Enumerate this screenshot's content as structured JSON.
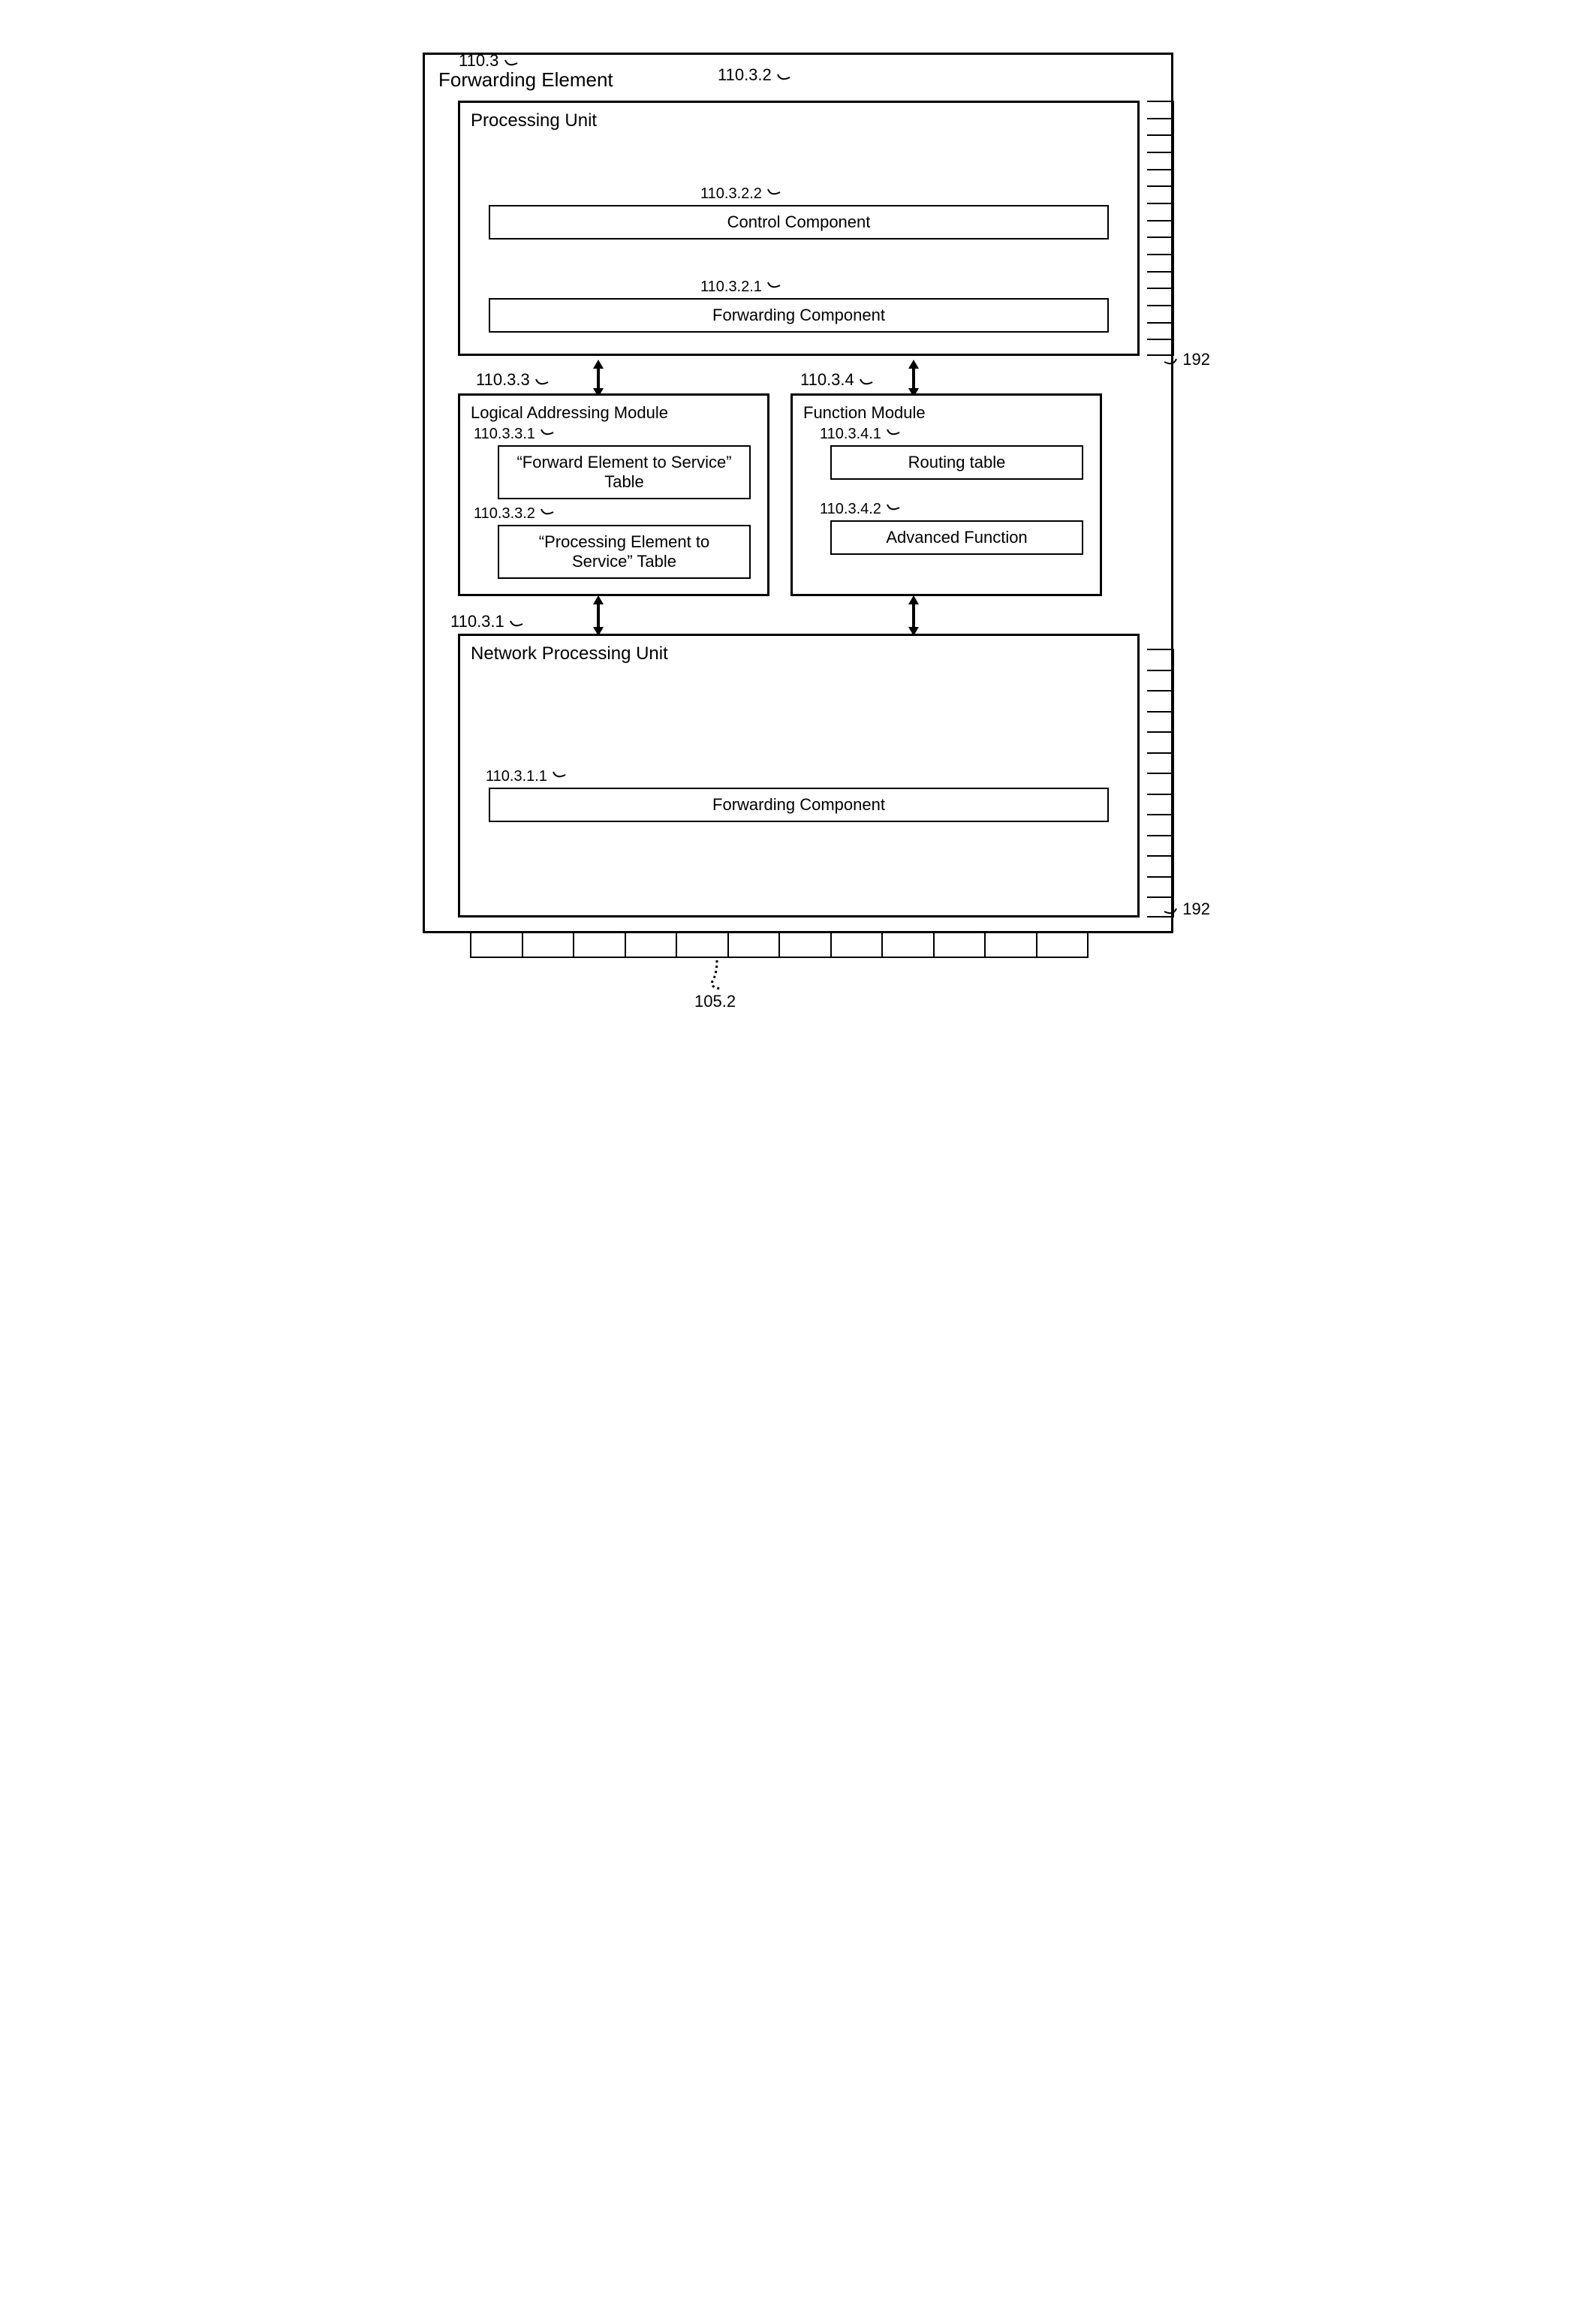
{
  "refs": {
    "forwarding_element": "110.3",
    "processing_unit": "110.3.2",
    "control_component": "110.3.2.2",
    "forwarding_component_pu": "110.3.2.1",
    "logical_addressing_module": "110.3.3",
    "fe_to_service": "110.3.3.1",
    "pe_to_service": "110.3.3.2",
    "function_module": "110.3.4",
    "routing_table": "110.3.4.1",
    "advanced_function": "110.3.4.2",
    "network_processing_unit": "110.3.1",
    "forwarding_component_npu": "110.3.1.1",
    "side_ports_top": "192",
    "side_ports_bottom": "192",
    "bottom_ports": "105.2"
  },
  "labels": {
    "forwarding_element": "Forwarding Element",
    "processing_unit": "Processing Unit",
    "control_component": "Control Component",
    "forwarding_component": "Forwarding Component",
    "logical_addressing_module": "Logical Addressing Module",
    "fe_to_service": "“Forward Element to Service” Table",
    "pe_to_service": "“Processing Element to Service” Table",
    "function_module": "Function Module",
    "routing_table": "Routing table",
    "advanced_function": "Advanced Function",
    "network_processing_unit": "Network Processing Unit"
  },
  "ports": {
    "side_top_count": 15,
    "side_bottom_count": 13,
    "bottom_count": 12
  }
}
